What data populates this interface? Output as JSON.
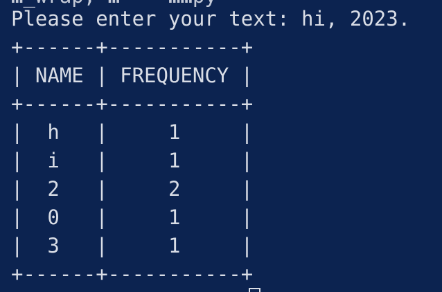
{
  "terminal": {
    "partial_top_line": "…_wrap; …    ……py",
    "prompt": "Please enter your text: hi, 2023.",
    "border_top": "+------+-----------+",
    "header_row": "| NAME | FREQUENCY |",
    "border_mid": "+------+-----------+",
    "rows": [
      "|  h   |     1     |",
      "|  i   |     1     |",
      "|  2   |     2     |",
      "|  0   |     1     |",
      "|  3   |     1     |"
    ],
    "border_bottom": "+------+-----------+",
    "table": {
      "columns": [
        "NAME",
        "FREQUENCY"
      ],
      "data": [
        [
          "h",
          "1"
        ],
        [
          "i",
          "1"
        ],
        [
          "2",
          "2"
        ],
        [
          "0",
          "1"
        ],
        [
          "3",
          "1"
        ]
      ]
    }
  },
  "colors": {
    "background": "#0c2350",
    "text": "#d9dde6"
  }
}
